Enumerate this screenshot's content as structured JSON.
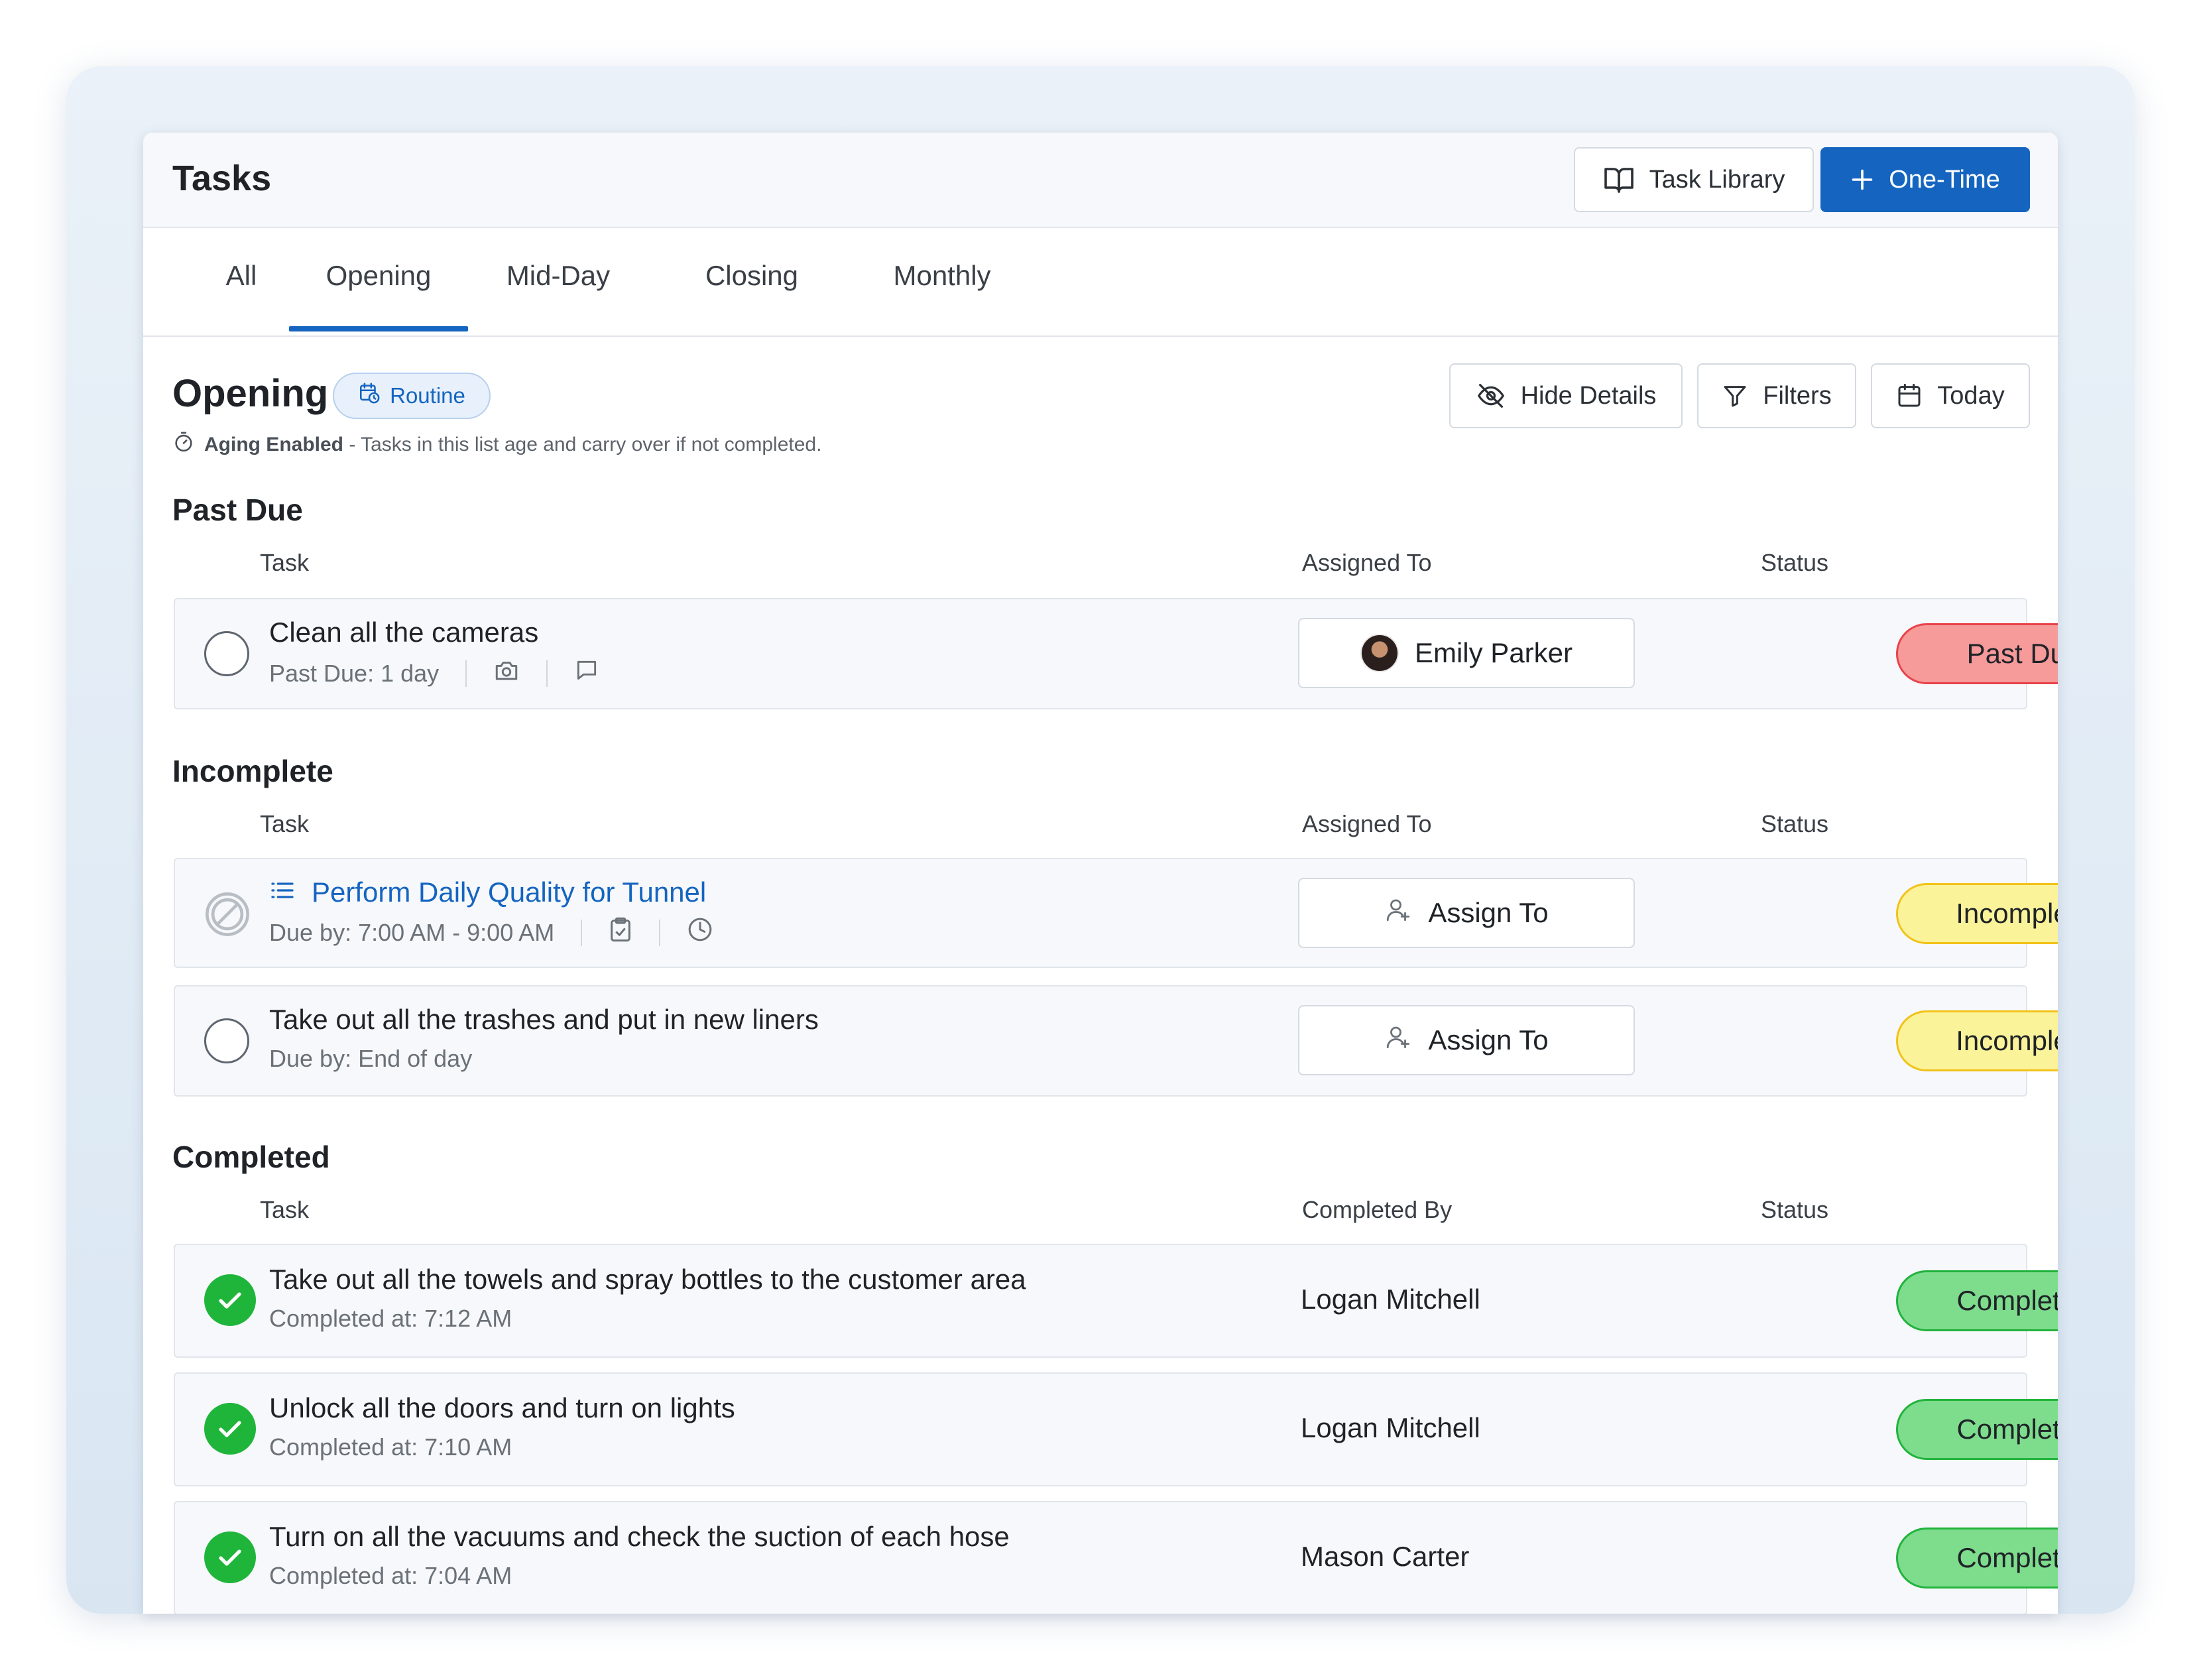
{
  "app": {
    "title": "Tasks"
  },
  "header": {
    "task_library_label": "Task Library",
    "one_time_label": "One-Time"
  },
  "tabs": [
    "All",
    "Opening",
    "Mid-Day",
    "Closing",
    "Monthly"
  ],
  "list": {
    "title": "Opening",
    "badge": "Routine",
    "aging_label": "Aging Enabled",
    "aging_text": " - Tasks in this list age and carry over if not completed."
  },
  "toolbar": {
    "hide_details": "Hide Details",
    "filters": "Filters",
    "today": "Today"
  },
  "past_due": {
    "title": "Past Due",
    "columns": [
      "Task",
      "Assigned To",
      "Status"
    ],
    "rows": [
      {
        "name": "Clean all the cameras",
        "sub": "Past Due: 1 day",
        "assignee": "Emily Parker",
        "status": "Past Due"
      }
    ]
  },
  "incomplete": {
    "title": "Incomplete",
    "columns": [
      "Task",
      "Assigned To",
      "Status"
    ],
    "rows": [
      {
        "name": "Perform Daily Quality for Tunnel",
        "sub": "Due by: 7:00 AM - 9:00 AM",
        "assignee": "Assign To",
        "status": "Incomplete"
      },
      {
        "name": "Take out all the trashes and put in new liners",
        "sub": "Due by: End of day",
        "assignee": "Assign To",
        "status": "Incomplete"
      }
    ]
  },
  "completed": {
    "title": "Completed",
    "columns": [
      "Task",
      "Completed By",
      "Status"
    ],
    "rows": [
      {
        "name": "Take out all the towels and spray bottles to the customer area",
        "sub": "Completed at: 7:12 AM",
        "by": "Logan Mitchell",
        "status": "Completed"
      },
      {
        "name": "Unlock all the doors and turn on lights",
        "sub": "Completed at: 7:10 AM",
        "by": "Logan Mitchell",
        "status": "Completed"
      },
      {
        "name": "Turn on all the vacuums and check the suction of each hose",
        "sub": "Completed at: 7:04 AM",
        "by": "Mason Carter",
        "status": "Completed"
      }
    ]
  },
  "colors": {
    "primary": "#1565c0",
    "past_due": "#f69a9a",
    "incomplete": "#fbf39a",
    "completed": "#7edc8d",
    "check": "#1fb53a"
  }
}
